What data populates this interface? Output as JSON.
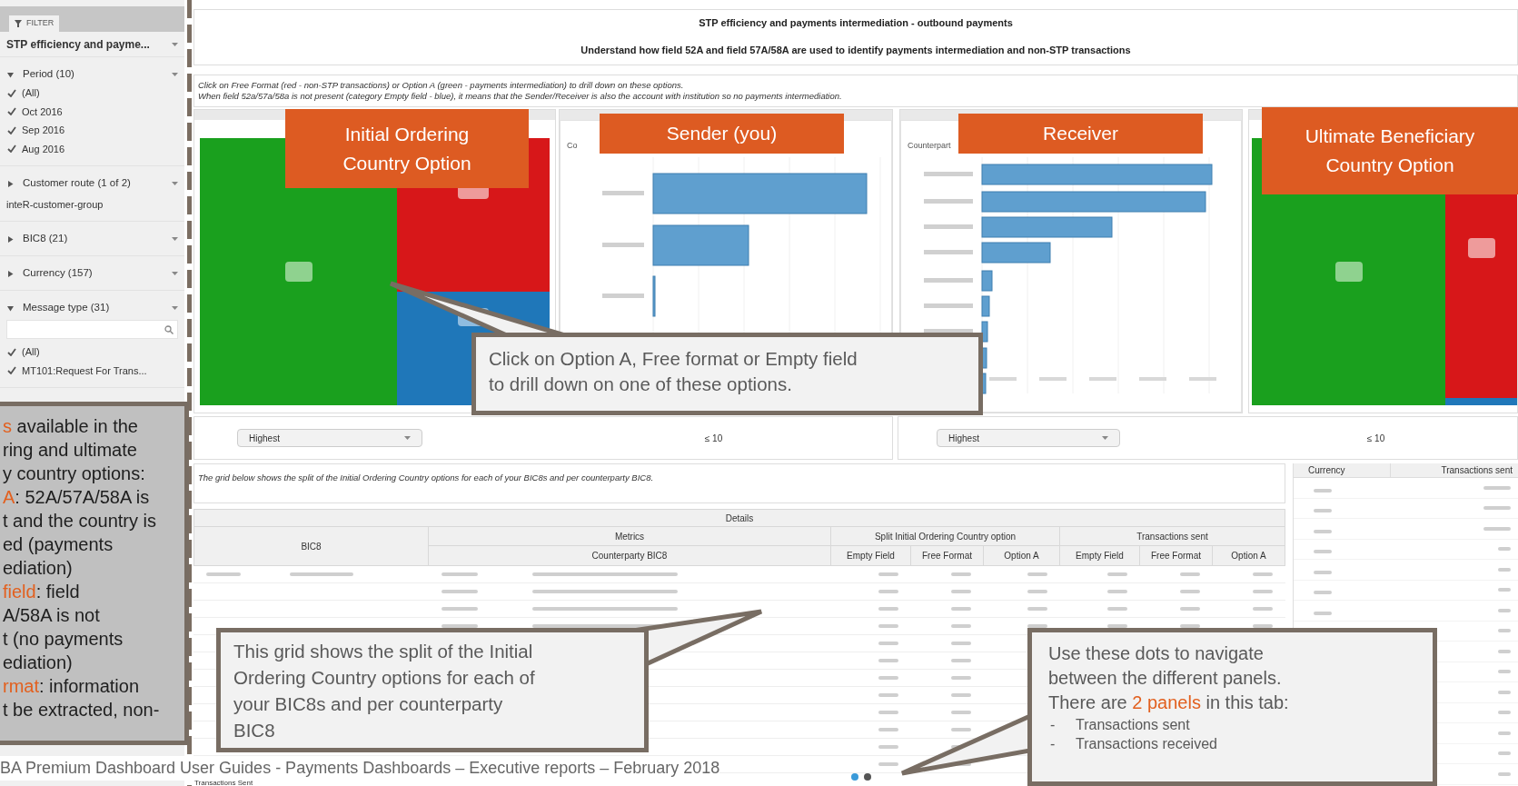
{
  "sidebar": {
    "tab": "FILTER",
    "sections": [
      {
        "kind": "dropdown",
        "title": "STP efficiency and payme..."
      },
      {
        "kind": "list",
        "title": "Period (10)",
        "expanded": true,
        "items": [
          {
            "label": "(All)",
            "checked": true
          },
          {
            "label": "Oct 2016",
            "checked": true
          },
          {
            "label": "Sep 2016",
            "checked": true
          },
          {
            "label": "Aug 2016",
            "checked": true
          }
        ]
      },
      {
        "kind": "value",
        "title": "Customer route (1 of 2)",
        "expanded": false,
        "value": "inteR-customer-group"
      },
      {
        "kind": "list",
        "title": "BIC8 (21)",
        "expanded": false
      },
      {
        "kind": "list",
        "title": "Currency (157)",
        "expanded": false
      },
      {
        "kind": "search_list",
        "title": "Message type (31)",
        "expanded": true,
        "items": [
          {
            "label": "(All)",
            "checked": true
          },
          {
            "label": "MT101:Request For Trans...",
            "checked": true
          }
        ]
      }
    ]
  },
  "header": {
    "title": "STP efficiency and payments intermediation - outbound payments",
    "subtitle": "Understand how field 52A and field 57A/58A are used to identify payments intermediation and non-STP transactions"
  },
  "info": [
    "Click on Free Format (red - non-STP transactions) or Option A (green - payments intermediation) to drill down on these options.",
    "When field 52a/57a/58a is not present (category Empty field - blue), it means that the Sender/Receiver is also the account with institution so no payments intermediation."
  ],
  "panels": [
    {
      "kind": "treemap"
    },
    {
      "kind": "bar",
      "axis_label": "Co"
    },
    {
      "kind": "bar",
      "axis_label": "Counterpart"
    },
    {
      "kind": "treemap"
    }
  ],
  "panel_labels": [
    "Initial Ordering Country Option",
    "Sender (you)",
    "Receiver",
    "Ultimate Beneficiary Country Option"
  ],
  "controls": [
    {
      "dropdown": "Highest",
      "limit": "≤ 10"
    },
    {
      "dropdown": "Highest",
      "limit": "≤ 10"
    }
  ],
  "grid_info": "The grid below shows the split of the Initial Ordering Country options for each of your BIC8s and per counterparty BIC8.",
  "details": {
    "title": "Details",
    "groups": [
      {
        "label": "BIC8"
      },
      {
        "label": "Metrics",
        "columns": [
          "Counterparty BIC8"
        ]
      },
      {
        "label": "Split Initial Ordering Country option",
        "columns": [
          "Empty Field",
          "Free Format",
          "Option A"
        ]
      },
      {
        "label": "Transactions sent",
        "columns": [
          "Empty Field",
          "Free Format",
          "Option A"
        ]
      }
    ]
  },
  "currency_table": {
    "columns": [
      "Currency",
      "Transactions sent"
    ]
  },
  "footer": "BA Premium Dashboard User Guides - Payments Dashboards – Executive reports – February 2018",
  "panel_title": "Transactions Sent",
  "page_dots": [
    {
      "selected": true
    },
    {
      "selected": false
    }
  ],
  "callouts": [
    {
      "lines": [
        [
          {
            "text": "s",
            "highlight": true
          },
          {
            "text": " available in the",
            "highlight": false
          }
        ],
        [
          {
            "text": "ring and ultimate",
            "highlight": false
          }
        ],
        [
          {
            "text": "y country options:",
            "highlight": false
          }
        ],
        [
          {
            "text": "A",
            "highlight": true
          },
          {
            "text": ": 52A/57A/58A is",
            "highlight": false
          }
        ],
        [
          {
            "text": "t and the country is",
            "highlight": false
          }
        ],
        [
          {
            "text": "ed (payments",
            "highlight": false
          }
        ],
        [
          {
            "text": "ediation)",
            "highlight": false
          }
        ],
        [
          {
            "text": "field",
            "highlight": true
          },
          {
            "text": ": field",
            "highlight": false
          }
        ],
        [
          {
            "text": "A/58A is not",
            "highlight": false
          }
        ],
        [
          {
            "text": "t (no payments",
            "highlight": false
          }
        ],
        [
          {
            "text": "ediation)",
            "highlight": false
          }
        ],
        [
          {
            "text": "rmat",
            "highlight": true
          },
          {
            "text": ": information",
            "highlight": false
          }
        ],
        [
          {
            "text": "t be extracted, non-",
            "highlight": false
          }
        ]
      ]
    },
    {
      "lines": [
        [
          {
            "text": "Click on Option A, Free format or Empty field",
            "highlight": false
          }
        ],
        [
          {
            "text": "to drill down on one of these options.",
            "highlight": false
          }
        ]
      ]
    },
    {
      "lines": [
        [
          {
            "text": "This grid shows the split of the Initial",
            "highlight": false
          }
        ],
        [
          {
            "text": "Ordering Country options for each of",
            "highlight": false
          }
        ],
        [
          {
            "text": "your BIC8s and per counterparty",
            "highlight": false
          }
        ],
        [
          {
            "text": "BIC8",
            "highlight": false
          }
        ]
      ]
    },
    {
      "lines": [
        [
          {
            "text": "Use these dots to navigate",
            "highlight": false
          }
        ],
        [
          {
            "text": "between the different panels.",
            "highlight": false
          }
        ],
        [
          {
            "text": "There are ",
            "highlight": false
          },
          {
            "text": "2 panels",
            "highlight": true
          },
          {
            "text": " in this tab:",
            "highlight": false
          }
        ]
      ],
      "bullet_mark": "-",
      "bullets": [
        "Transactions sent",
        "Transactions received"
      ]
    }
  ]
}
